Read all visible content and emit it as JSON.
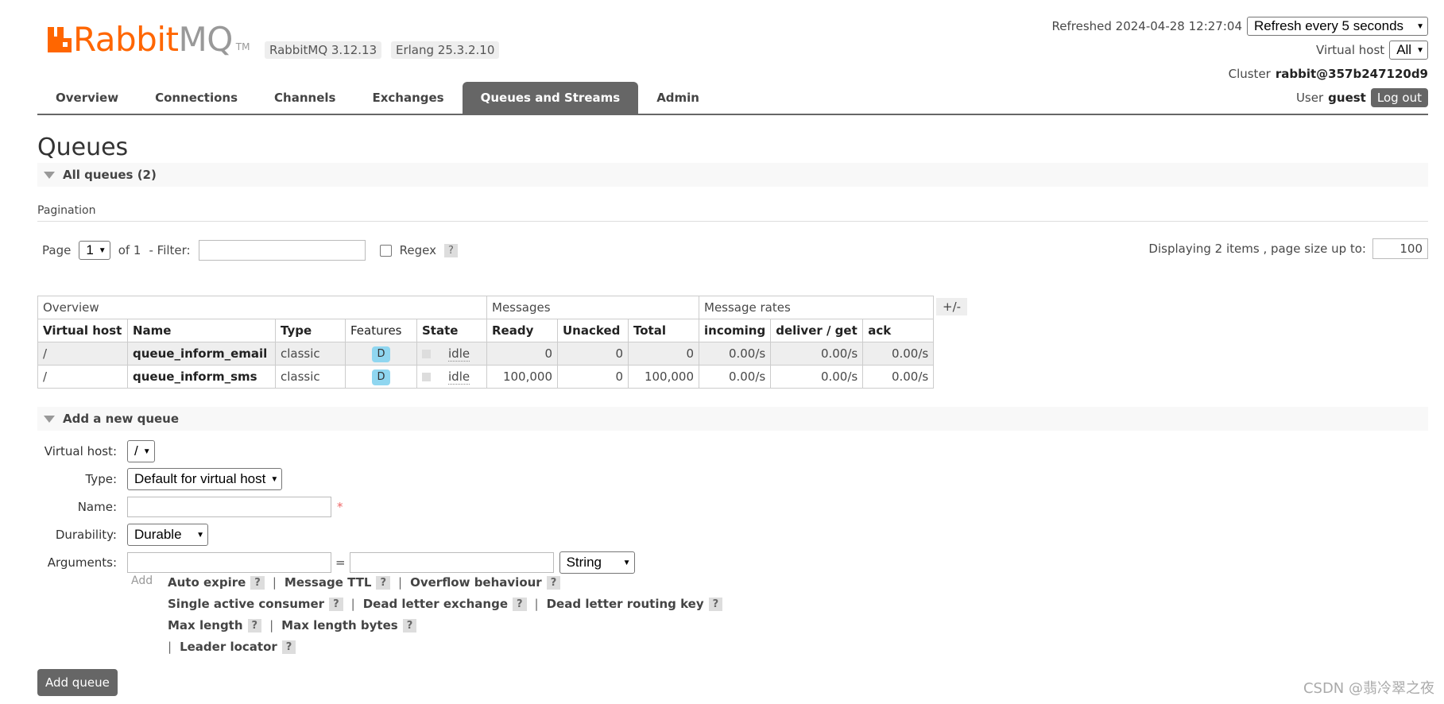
{
  "header": {
    "logo_brand": "Rabbit",
    "logo_mq": "MQ",
    "logo_tm": "TM",
    "version": "RabbitMQ 3.12.13",
    "erlang": "Erlang 25.3.2.10",
    "refreshed": "Refreshed 2024-04-28 12:27:04",
    "refresh_select": "Refresh every 5 seconds",
    "vhost_label": "Virtual host",
    "vhost_select": "All",
    "cluster_label": "Cluster",
    "cluster_name": "rabbit@357b247120d9",
    "user_label": "User",
    "user_name": "guest",
    "logout_label": "Log out"
  },
  "nav": {
    "tabs": [
      "Overview",
      "Connections",
      "Channels",
      "Exchanges",
      "Queues and Streams",
      "Admin"
    ],
    "active": "Queues and Streams"
  },
  "page": {
    "title": "Queues",
    "all_queues": "All queues (2)",
    "pagination_label": "Pagination",
    "page_label": "Page",
    "page_value": "1",
    "of_label": "of 1",
    "filter_label": "- Filter:",
    "regex_label": "Regex",
    "help": "?",
    "displaying": "Displaying 2 items , page size up to:",
    "page_size": "100"
  },
  "table": {
    "groups": [
      "Overview",
      "Messages",
      "Message rates"
    ],
    "plus_minus": "+/-",
    "columns": [
      "Virtual host",
      "Name",
      "Type",
      "Features",
      "State",
      "Ready",
      "Unacked",
      "Total",
      "incoming",
      "deliver / get",
      "ack"
    ],
    "rows": [
      {
        "vhost": "/",
        "name": "queue_inform_email",
        "type": "classic",
        "feature": "D",
        "state": "idle",
        "ready": "0",
        "unacked": "0",
        "total": "0",
        "incoming": "0.00/s",
        "deliver": "0.00/s",
        "ack": "0.00/s"
      },
      {
        "vhost": "/",
        "name": "queue_inform_sms",
        "type": "classic",
        "feature": "D",
        "state": "idle",
        "ready": "100,000",
        "unacked": "0",
        "total": "100,000",
        "incoming": "0.00/s",
        "deliver": "0.00/s",
        "ack": "0.00/s"
      }
    ]
  },
  "add_queue": {
    "section": "Add a new queue",
    "vhost_label": "Virtual host:",
    "vhost_value": "/",
    "type_label": "Type:",
    "type_value": "Default for virtual host",
    "name_label": "Name:",
    "required": "*",
    "durability_label": "Durability:",
    "durability_value": "Durable",
    "arguments_label": "Arguments:",
    "equals": "=",
    "arg_type_value": "String",
    "add_small": "Add",
    "links": {
      "auto_expire": "Auto expire",
      "message_ttl": "Message TTL",
      "overflow": "Overflow behaviour",
      "single_active": "Single active consumer",
      "dlx": "Dead letter exchange",
      "dlrk": "Dead letter routing key",
      "max_length": "Max length",
      "max_length_bytes": "Max length bytes",
      "leader_locator": "Leader locator"
    },
    "separator": "|",
    "button": "Add queue"
  },
  "watermark": "CSDN @翡冷翠之夜",
  "colors": {
    "brand": "#ff6600",
    "tab_active": "#666666",
    "pill": "#8fd6f0"
  }
}
